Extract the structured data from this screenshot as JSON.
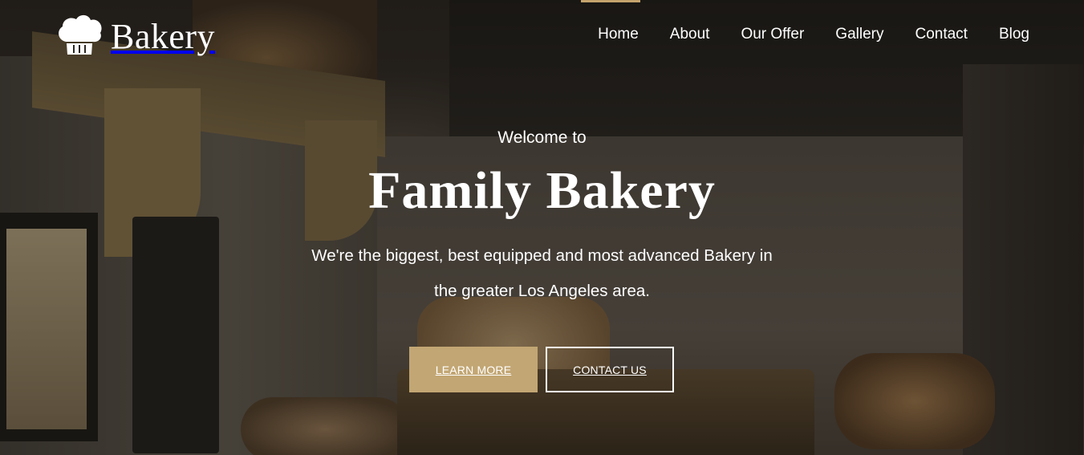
{
  "brand": {
    "name": "Bakery",
    "logo_icon": "chef-hat-icon"
  },
  "nav": {
    "items": [
      {
        "label": "Home"
      },
      {
        "label": "About"
      },
      {
        "label": "Our Offer"
      },
      {
        "label": "Gallery"
      },
      {
        "label": "Contact"
      },
      {
        "label": "Blog"
      }
    ]
  },
  "hero": {
    "welcome": "Welcome to",
    "title": "Family Bakery",
    "description_line1": "We're the biggest, best equipped and most advanced Bakery in",
    "description_line2": "the greater Los Angeles area.",
    "learn_more": "LEARN MORE",
    "contact_us": "CONTACT US"
  },
  "colors": {
    "accent": "#c2a673",
    "text": "#ffffff"
  }
}
